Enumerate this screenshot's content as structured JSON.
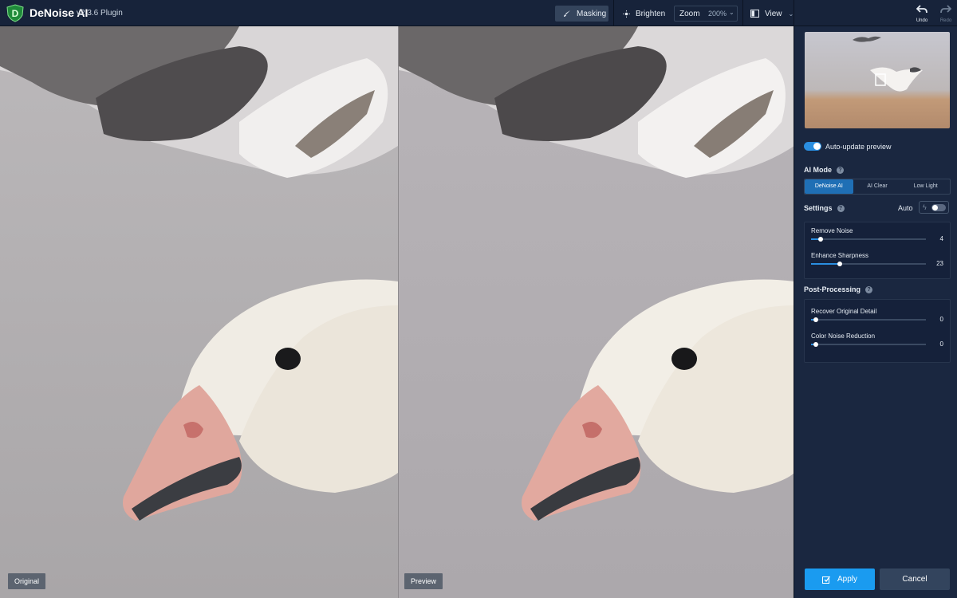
{
  "app": {
    "title": "DeNoise AI",
    "version": "v2.3.6 Plugin"
  },
  "toolbar": {
    "masking_label": "Masking",
    "brighten_label": "Brighten",
    "zoom_label": "Zoom",
    "zoom_value": "200%",
    "view_label": "View",
    "undo_label": "Undo",
    "redo_label": "Redo"
  },
  "panes": {
    "original_label": "Original",
    "preview_label": "Preview"
  },
  "sidebar": {
    "auto_update_label": "Auto-update preview",
    "auto_update_on": true,
    "ai_mode_title": "AI Mode",
    "ai_modes": [
      "DeNoise AI",
      "AI Clear",
      "Low Light"
    ],
    "ai_mode_selected": "DeNoise AI",
    "settings_title": "Settings",
    "auto_label": "Auto",
    "auto_on": false,
    "settings_sliders": [
      {
        "label": "Remove Noise",
        "value": "4",
        "fraction": 0.08
      },
      {
        "label": "Enhance Sharpness",
        "value": "23",
        "fraction": 0.25
      }
    ],
    "post_processing_title": "Post-Processing",
    "post_sliders": [
      {
        "label": "Recover Original Detail",
        "value": "0",
        "fraction": 0.04
      },
      {
        "label": "Color Noise Reduction",
        "value": "0",
        "fraction": 0.04
      }
    ],
    "apply_label": "Apply",
    "cancel_label": "Cancel"
  },
  "colors": {
    "accent": "#1a9bf0",
    "panel": "#1a2740",
    "topbar": "#17233a"
  }
}
